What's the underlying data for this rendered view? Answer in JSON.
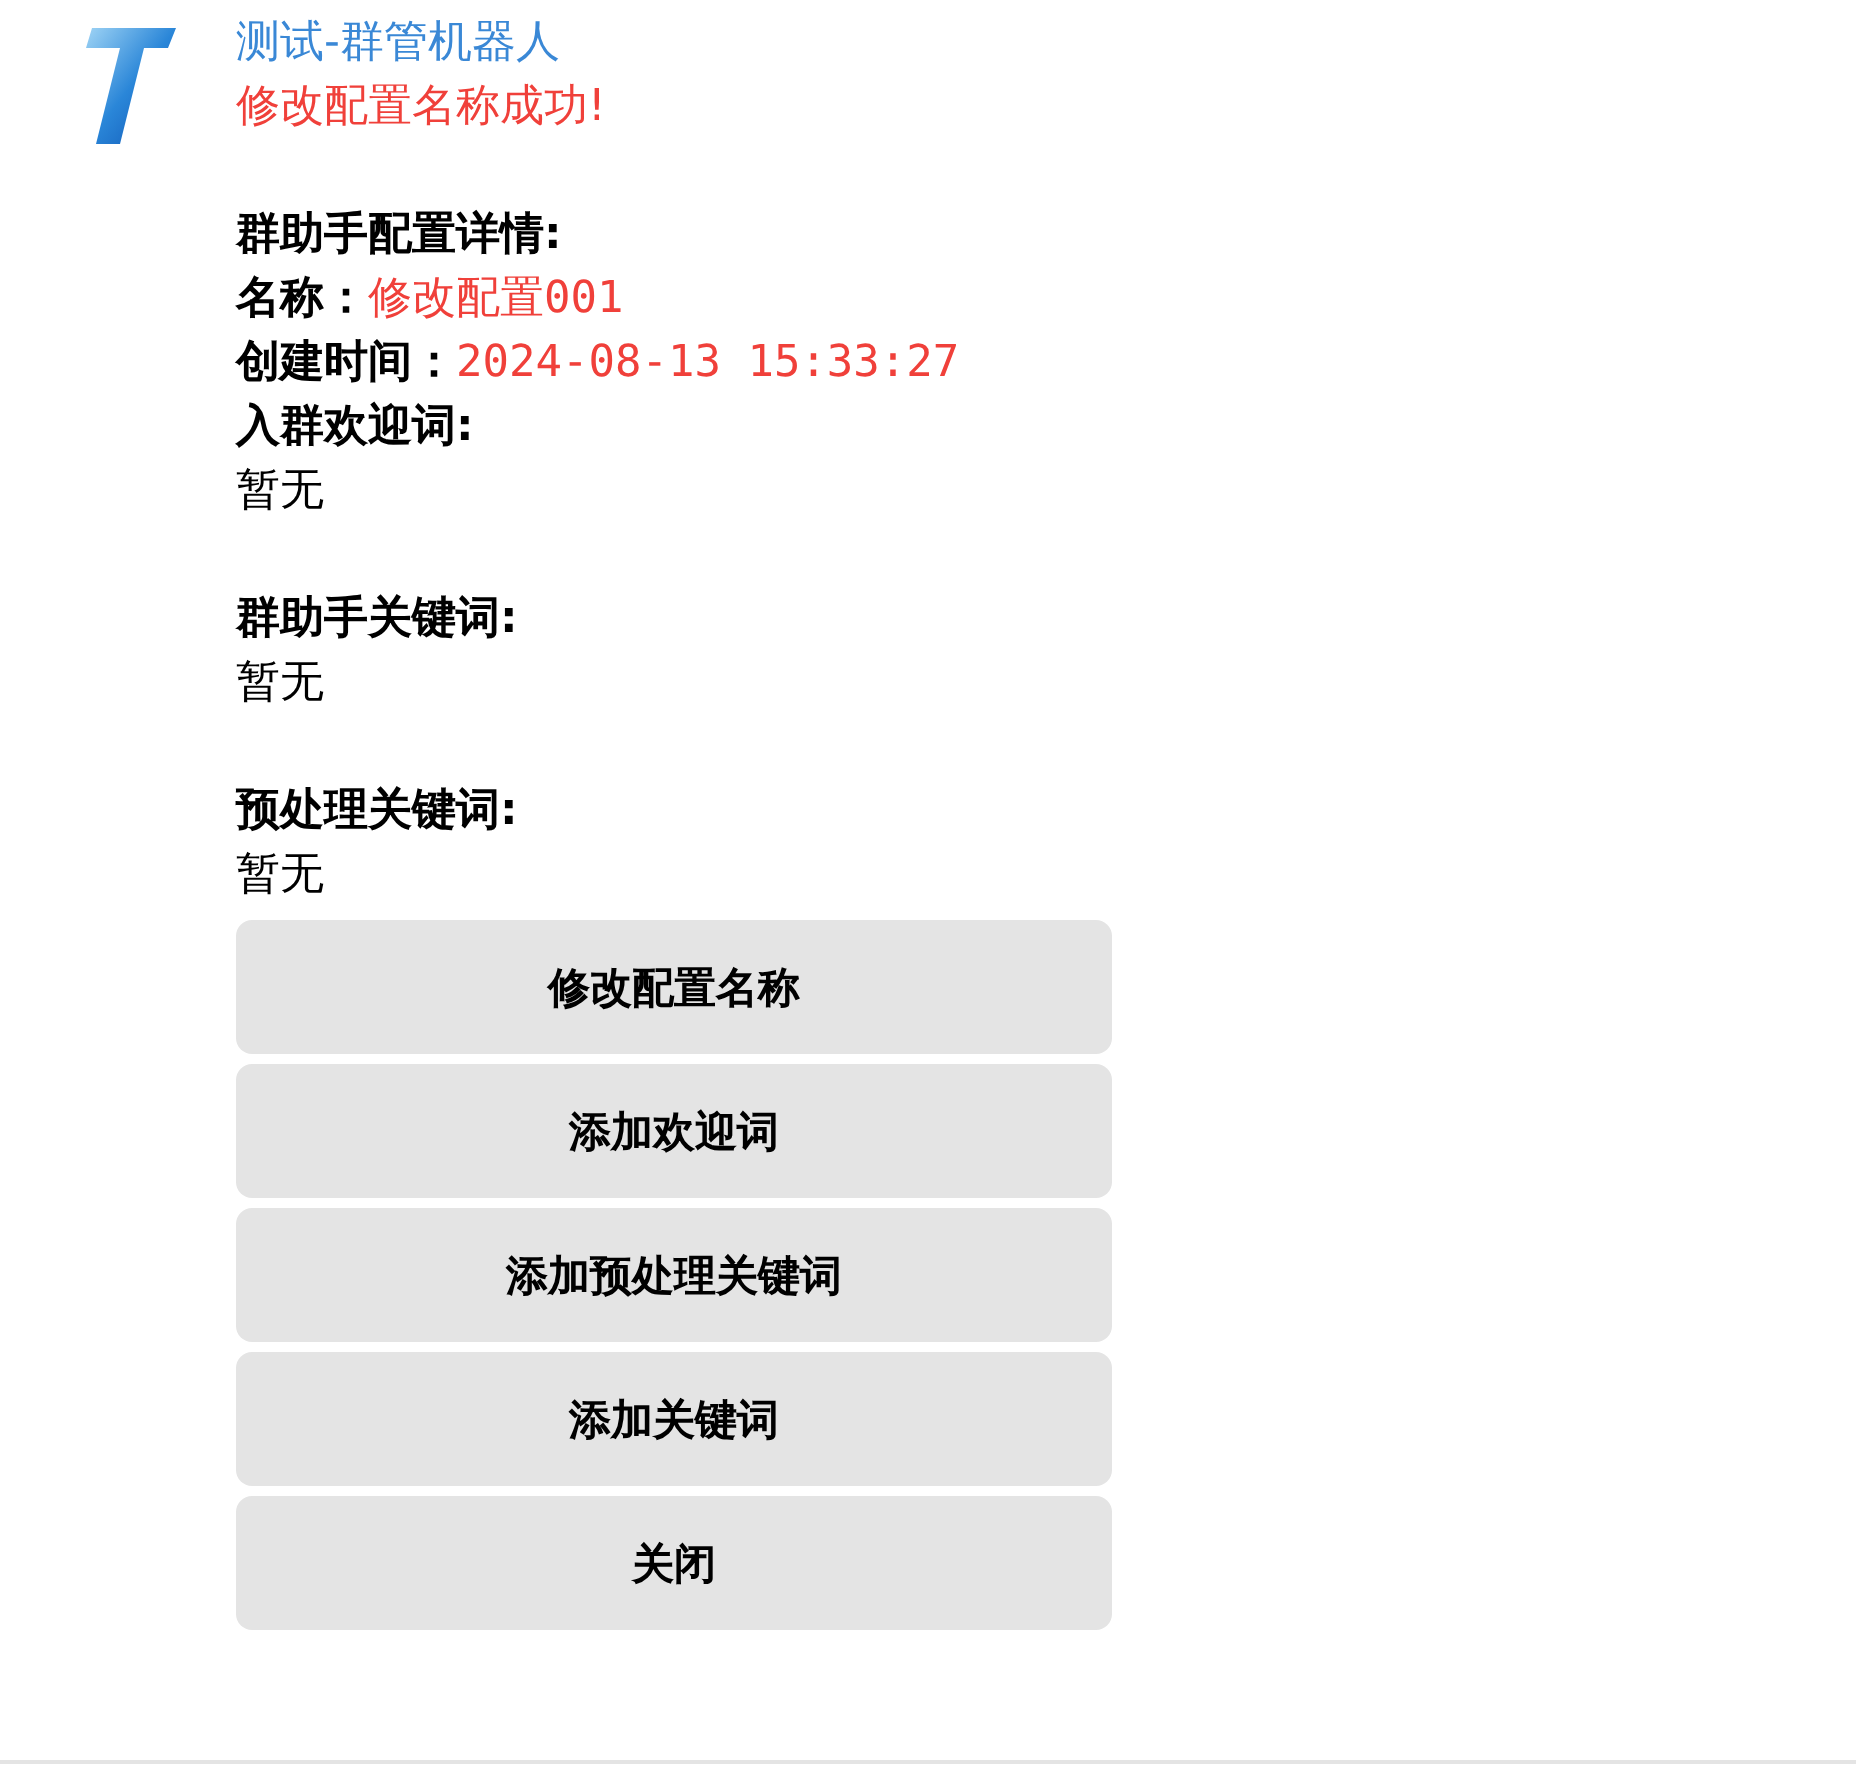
{
  "message": {
    "sender": "测试-群管机器人",
    "status": "修改配置名称成功!",
    "details_title": "群助手配置详情:",
    "fields": [
      {
        "label": "名称：",
        "value": "修改配置001"
      },
      {
        "label": "创建时间：",
        "value": "2024-08-13 15:33:27"
      }
    ],
    "sections": [
      {
        "label": "入群欢迎词:",
        "value": "暂无"
      },
      {
        "label": "群助手关键词:",
        "value": "暂无"
      },
      {
        "label": "预处理关键词:",
        "value": "暂无"
      }
    ]
  },
  "buttons": [
    "修改配置名称",
    "添加欢迎词",
    "添加预处理关键词",
    "添加关键词",
    "关闭"
  ]
}
